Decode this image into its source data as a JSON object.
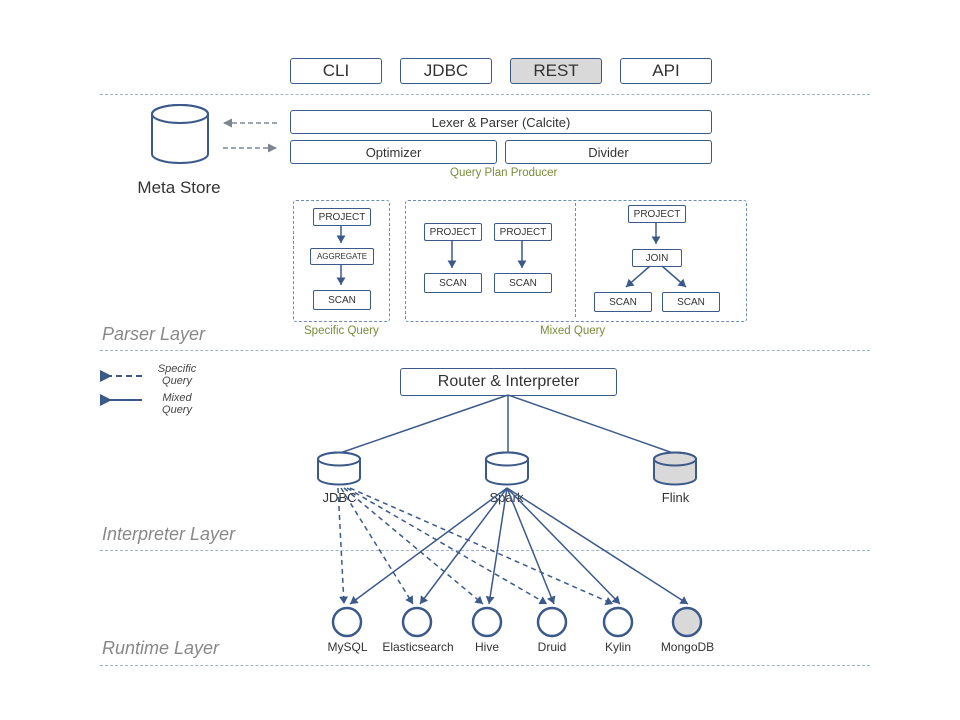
{
  "top_tabs": {
    "cli": "CLI",
    "jdbc": "JDBC",
    "rest": "REST",
    "api": "API"
  },
  "parser": {
    "lexer": "Lexer & Parser (Calcite)",
    "optimizer": "Optimizer",
    "divider": "Divider",
    "producer_label": "Query Plan Producer",
    "meta_store": "Meta Store",
    "plan": {
      "project": "PROJECT",
      "aggregate": "AGGREGATE",
      "scan": "SCAN",
      "join": "JOIN"
    },
    "specific_label": "Specific Query",
    "mixed_label": "Mixed Query",
    "layer_label": "Parser Layer"
  },
  "interpreter": {
    "router": "Router & Interpreter",
    "engines": {
      "jdbc": "JDBC",
      "spark": "Spark",
      "flink": "Flink"
    },
    "legend": {
      "specific": "Specific Query",
      "mixed": "Mixed Query"
    },
    "layer_label": "Interpreter Layer"
  },
  "runtime": {
    "dbs": {
      "mysql": "MySQL",
      "es": "Elasticsearch",
      "hive": "Hive",
      "druid": "Druid",
      "kylin": "Kylin",
      "mongo": "MongoDB"
    },
    "layer_label": "Runtime Layer"
  }
}
